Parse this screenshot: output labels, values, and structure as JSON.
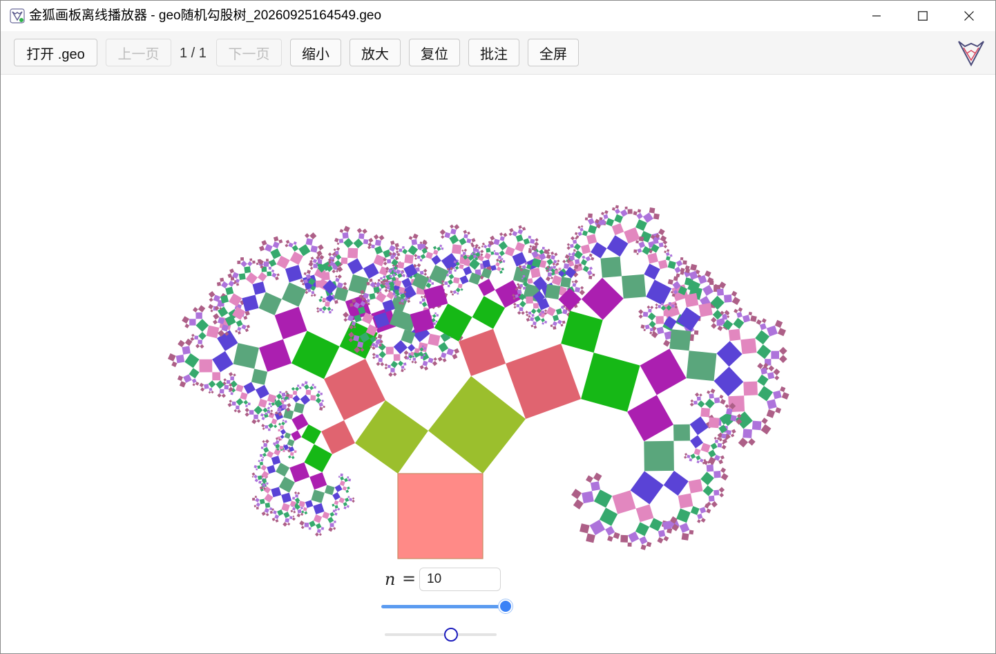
{
  "window": {
    "title": "金狐画板离线播放器 - geo随机勾股树_20260925164549.geo",
    "minimize_icon": "minimize-icon",
    "maximize_icon": "maximize-icon",
    "close_icon": "close-icon"
  },
  "toolbar": {
    "open_label": "打开 .geo",
    "prev_label": "上一页",
    "page_indicator": "1 / 1",
    "next_label": "下一页",
    "zoom_out_label": "缩小",
    "zoom_in_label": "放大",
    "reset_label": "复位",
    "annotate_label": "批注",
    "fullscreen_label": "全屏",
    "prev_disabled": true,
    "next_disabled": true,
    "logo_icon": "fox-logo-icon"
  },
  "controls": {
    "n_label": "n",
    "n_equals": "=",
    "n_value": "10",
    "depth_slider_level": 1.0,
    "angle_slider_level": 0.6
  },
  "colors": {
    "root_square": "#ff8a87",
    "root_border": "#c98b63",
    "palette": [
      "#9bbf2d",
      "#e06470",
      "#16b816",
      "#ab1fb0",
      "#5aa67c",
      "#5a43d6",
      "#e287bf",
      "#36a96d",
      "#ad73db",
      "#ad5f87"
    ],
    "slider_active": "#3b82f6",
    "slider_thumb2_border": "#1d1dbd"
  },
  "tree": {
    "depth": 10
  }
}
